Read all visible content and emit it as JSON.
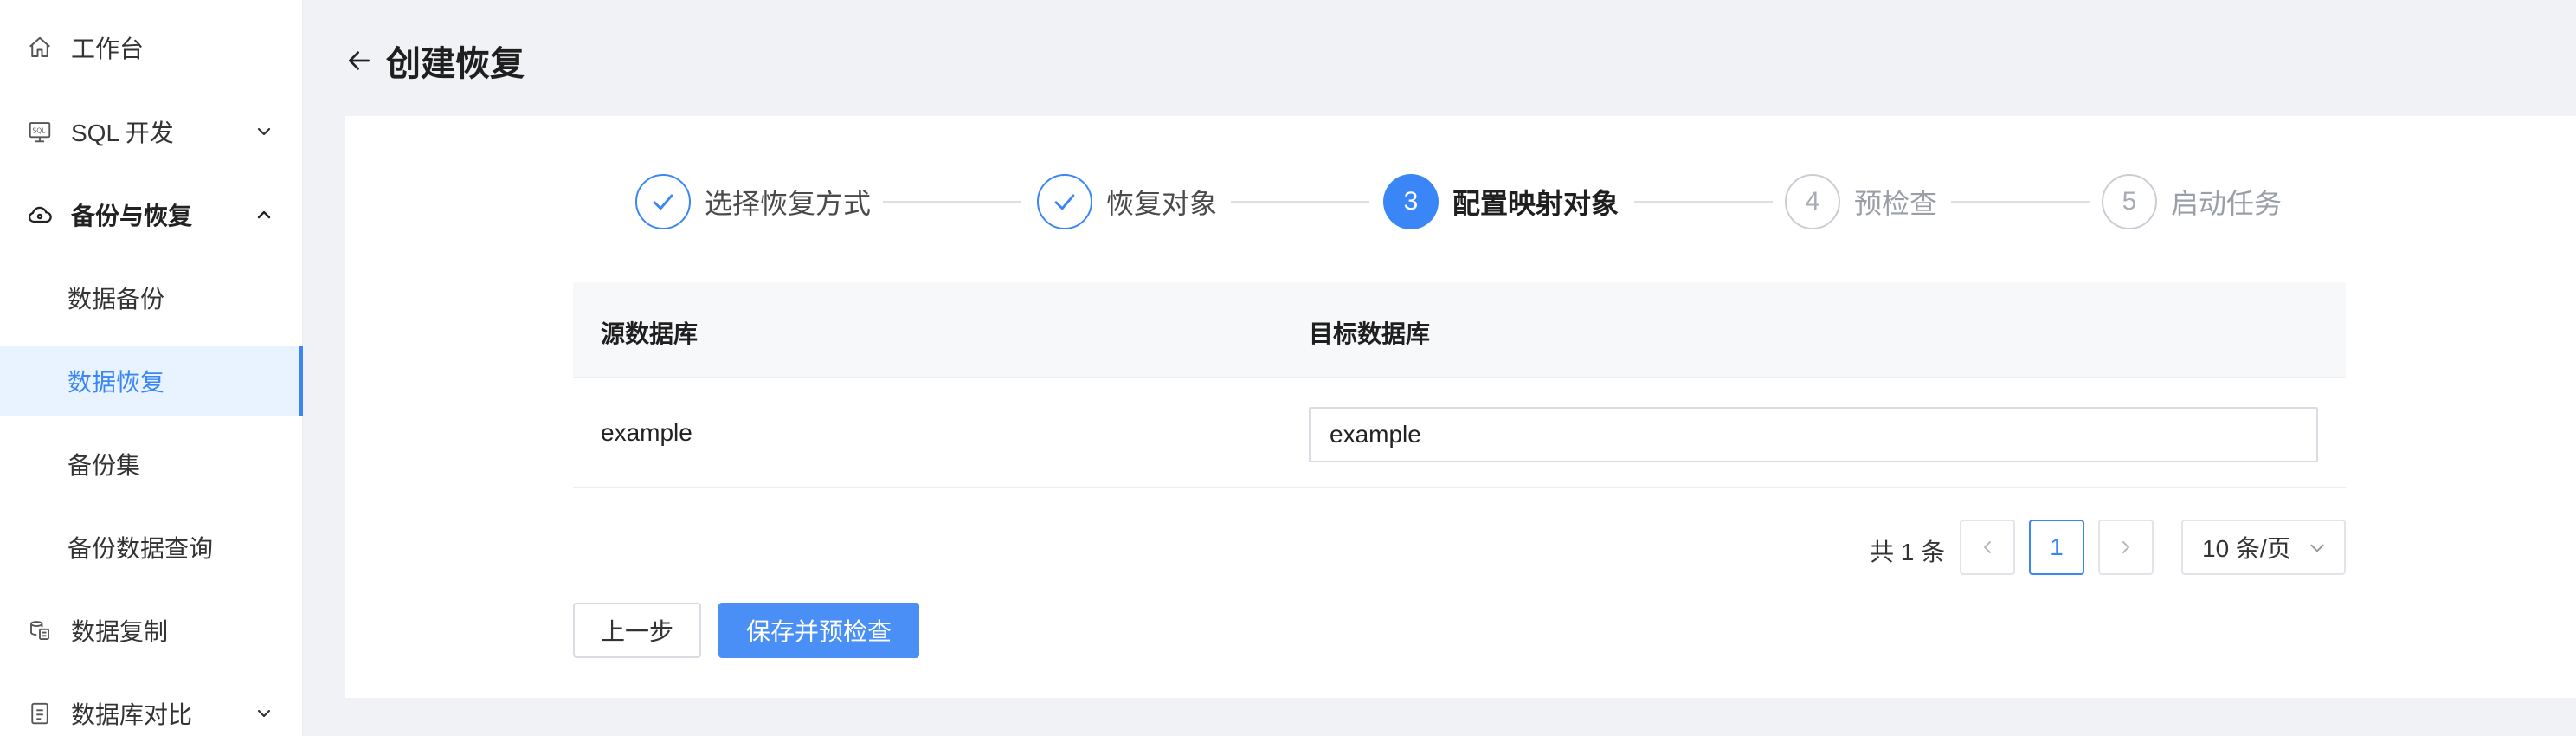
{
  "sidebar": {
    "items": [
      {
        "label": "工作台",
        "icon": "home-icon"
      },
      {
        "label": "SQL 开发",
        "icon": "sql-icon"
      },
      {
        "label": "备份与恢复",
        "icon": "cloud-backup-icon"
      },
      {
        "label": "数据复制",
        "icon": "data-copy-icon"
      },
      {
        "label": "数据库对比",
        "icon": "compare-icon"
      }
    ],
    "sub_items": [
      {
        "label": "数据备份"
      },
      {
        "label": "数据恢复"
      },
      {
        "label": "备份集"
      },
      {
        "label": "备份数据查询"
      }
    ]
  },
  "header": {
    "title": "创建恢复"
  },
  "steps": [
    {
      "number": "1",
      "label": "选择恢复方式",
      "status": "done"
    },
    {
      "number": "2",
      "label": "恢复对象",
      "status": "done"
    },
    {
      "number": "3",
      "label": "配置映射对象",
      "status": "current"
    },
    {
      "number": "4",
      "label": "预检查",
      "status": "todo"
    },
    {
      "number": "5",
      "label": "启动任务",
      "status": "todo"
    }
  ],
  "table": {
    "columns": [
      "源数据库",
      "目标数据库"
    ],
    "rows": [
      {
        "source": "example",
        "target": "example"
      }
    ]
  },
  "pagination": {
    "total_text": "共 1 条",
    "prev": "<",
    "current_page": "1",
    "next": ">",
    "page_size": "10 条/页"
  },
  "actions": {
    "prev_step": "上一步",
    "save_and_check": "保存并预检查"
  },
  "colors": {
    "primary": "#3a86f7",
    "active_bg": "#e8f3ff",
    "page_bg": "#f0f2f5"
  }
}
